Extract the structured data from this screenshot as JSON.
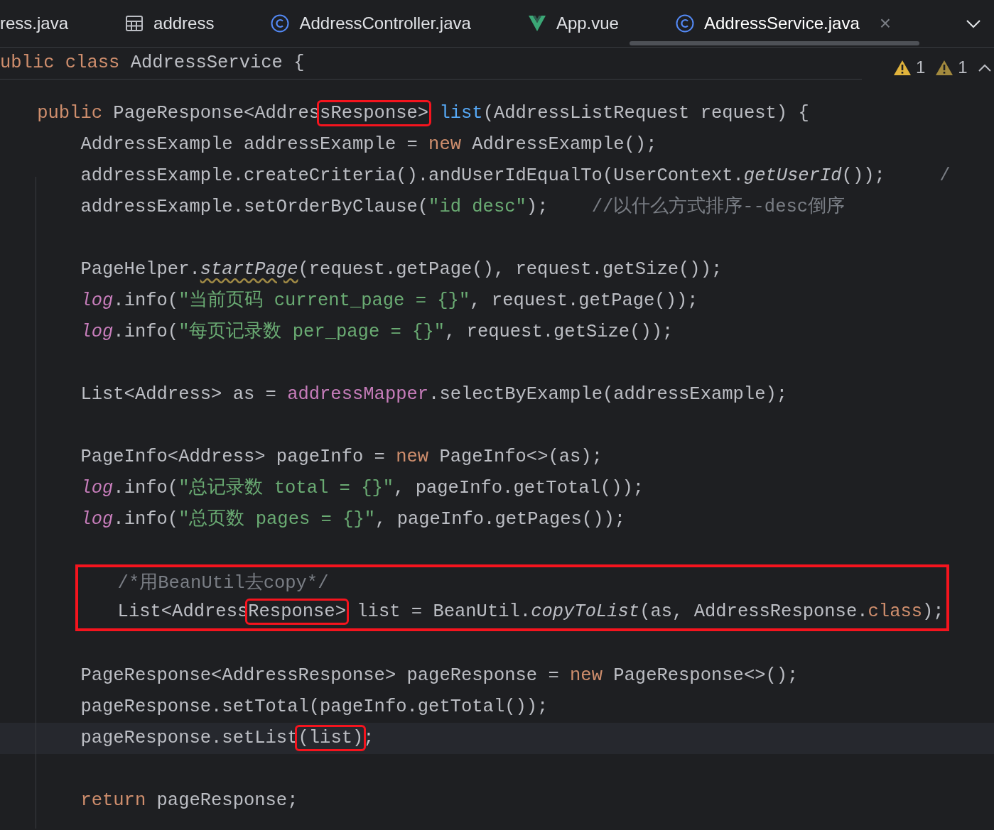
{
  "tabs": [
    {
      "label": "ress.java",
      "kind": "clipped",
      "selected": false
    },
    {
      "label": "address",
      "kind": "table",
      "selected": false
    },
    {
      "label": "AddressController.java",
      "kind": "class",
      "selected": false
    },
    {
      "label": "App.vue",
      "kind": "vue",
      "selected": false
    },
    {
      "label": "AddressService.java",
      "kind": "class",
      "selected": true,
      "close": "×"
    }
  ],
  "header": {
    "tokens": [
      {
        "t": "ublic",
        "kind": "keyword"
      },
      {
        "t": " class",
        "kind": "keyword"
      },
      {
        "t": " AddressService {",
        "kind": "plain"
      }
    ]
  },
  "inspections": [
    {
      "kind": "warning",
      "count": "1"
    },
    {
      "kind": "weak_warning",
      "count": "1"
    }
  ],
  "lines": [
    {
      "kind": "code",
      "current": false,
      "tokens": [
        {
          "t": "public",
          "kind": "keyword"
        },
        {
          "t": " PageResponse<Addres",
          "kind": "plain"
        },
        {
          "t": "sResponse>",
          "kind": "plain",
          "boxed": true
        },
        {
          "t": " list",
          "kind": "decl"
        },
        {
          "t": "(AddressListRequest request) {",
          "kind": "plain"
        }
      ],
      "children": [
        {
          "kind": "code",
          "current": false,
          "tokens": [
            {
              "t": "AddressExample addressExample = ",
              "kind": "plain"
            },
            {
              "t": "new",
              "kind": "keyword"
            },
            {
              "t": " AddressExample();",
              "kind": "plain"
            }
          ]
        },
        {
          "kind": "code",
          "current": false,
          "tokens": [
            {
              "t": "addressExample.createCriteria().andUserIdEqualTo(UserContext.",
              "kind": "plain"
            },
            {
              "t": "getUserId",
              "kind": "static"
            },
            {
              "t": "());",
              "kind": "plain"
            },
            {
              "t": "     /",
              "kind": "comment"
            }
          ]
        },
        {
          "kind": "code",
          "current": false,
          "tokens": [
            {
              "t": "addressExample.setOrderByClause(",
              "kind": "plain"
            },
            {
              "t": "\"id desc\"",
              "kind": "string"
            },
            {
              "t": ");",
              "kind": "plain"
            },
            {
              "t": "    //以什么方式排序--desc倒序",
              "kind": "comment"
            }
          ]
        },
        {
          "kind": "blank"
        },
        {
          "kind": "code",
          "current": false,
          "tokens": [
            {
              "t": "PageHelper.",
              "kind": "plain"
            },
            {
              "t": "startPage",
              "kind": "static_warn"
            },
            {
              "t": "(request.getPage(), request.getSize());",
              "kind": "plain"
            }
          ]
        },
        {
          "kind": "code",
          "current": false,
          "tokens": [
            {
              "t": "log",
              "kind": "static_field"
            },
            {
              "t": ".info(",
              "kind": "plain"
            },
            {
              "t": "\"当前页码 current_page = {}\"",
              "kind": "string"
            },
            {
              "t": ", request.getPage());",
              "kind": "plain"
            }
          ]
        },
        {
          "kind": "code",
          "current": false,
          "tokens": [
            {
              "t": "log",
              "kind": "static_field"
            },
            {
              "t": ".info(",
              "kind": "plain"
            },
            {
              "t": "\"每页记录数 per_page = {}\"",
              "kind": "string"
            },
            {
              "t": ", request.getSize());",
              "kind": "plain"
            }
          ]
        },
        {
          "kind": "blank"
        },
        {
          "kind": "code",
          "current": false,
          "tokens": [
            {
              "t": "List<Address> as = ",
              "kind": "plain"
            },
            {
              "t": "addressMapper",
              "kind": "field"
            },
            {
              "t": ".selectByExample(addressExample);",
              "kind": "plain"
            }
          ]
        },
        {
          "kind": "blank"
        },
        {
          "kind": "code",
          "current": false,
          "tokens": [
            {
              "t": "PageInfo<Address> pageInfo = ",
              "kind": "plain"
            },
            {
              "t": "new",
              "kind": "keyword"
            },
            {
              "t": " PageInfo<>(as);",
              "kind": "plain"
            }
          ]
        },
        {
          "kind": "code",
          "current": false,
          "tokens": [
            {
              "t": "log",
              "kind": "static_field"
            },
            {
              "t": ".info(",
              "kind": "plain"
            },
            {
              "t": "\"总记录数 total = {}\"",
              "kind": "string"
            },
            {
              "t": ", pageInfo.getTotal());",
              "kind": "plain"
            }
          ]
        },
        {
          "kind": "code",
          "current": false,
          "tokens": [
            {
              "t": "log",
              "kind": "static_field"
            },
            {
              "t": ".info(",
              "kind": "plain"
            },
            {
              "t": "\"总页数 pages = {}\"",
              "kind": "string"
            },
            {
              "t": ", pageInfo.getPages());",
              "kind": "plain"
            }
          ]
        },
        {
          "kind": "blank"
        },
        {
          "kind": "group",
          "boxed": true,
          "lines": [
            {
              "kind": "code",
              "current": false,
              "tokens": [
                {
                  "t": "/*用BeanUtil去copy*/",
                  "kind": "comment"
                }
              ]
            },
            {
              "kind": "code",
              "current": false,
              "tokens": [
                {
                  "t": "List<Address",
                  "kind": "plain"
                },
                {
                  "t": "Response>",
                  "kind": "plain",
                  "boxed": true
                },
                {
                  "t": " list = BeanUtil.",
                  "kind": "plain"
                },
                {
                  "t": "copyToList",
                  "kind": "static"
                },
                {
                  "t": "(as, AddressResponse.",
                  "kind": "plain"
                },
                {
                  "t": "class",
                  "kind": "keyword"
                },
                {
                  "t": ");",
                  "kind": "plain"
                }
              ]
            }
          ]
        },
        {
          "kind": "blank"
        },
        {
          "kind": "code",
          "current": false,
          "tokens": [
            {
              "t": "PageResponse<AddressResponse> pageResponse = ",
              "kind": "plain"
            },
            {
              "t": "new",
              "kind": "keyword"
            },
            {
              "t": " PageResponse<>();",
              "kind": "plain"
            }
          ]
        },
        {
          "kind": "code",
          "current": false,
          "tokens": [
            {
              "t": "pageResponse.setTotal(pageInfo.getTotal());",
              "kind": "plain"
            }
          ]
        },
        {
          "kind": "code",
          "current": true,
          "tokens": [
            {
              "t": "pageResponse.setList",
              "kind": "plain"
            },
            {
              "t": "(list)",
              "kind": "plain",
              "boxed": true
            },
            {
              "t": ";",
              "kind": "plain"
            }
          ]
        },
        {
          "kind": "blank"
        },
        {
          "kind": "code",
          "current": false,
          "tokens": [
            {
              "t": "return",
              "kind": "keyword"
            },
            {
              "t": " pageResponse;",
              "kind": "plain"
            }
          ]
        }
      ]
    }
  ]
}
